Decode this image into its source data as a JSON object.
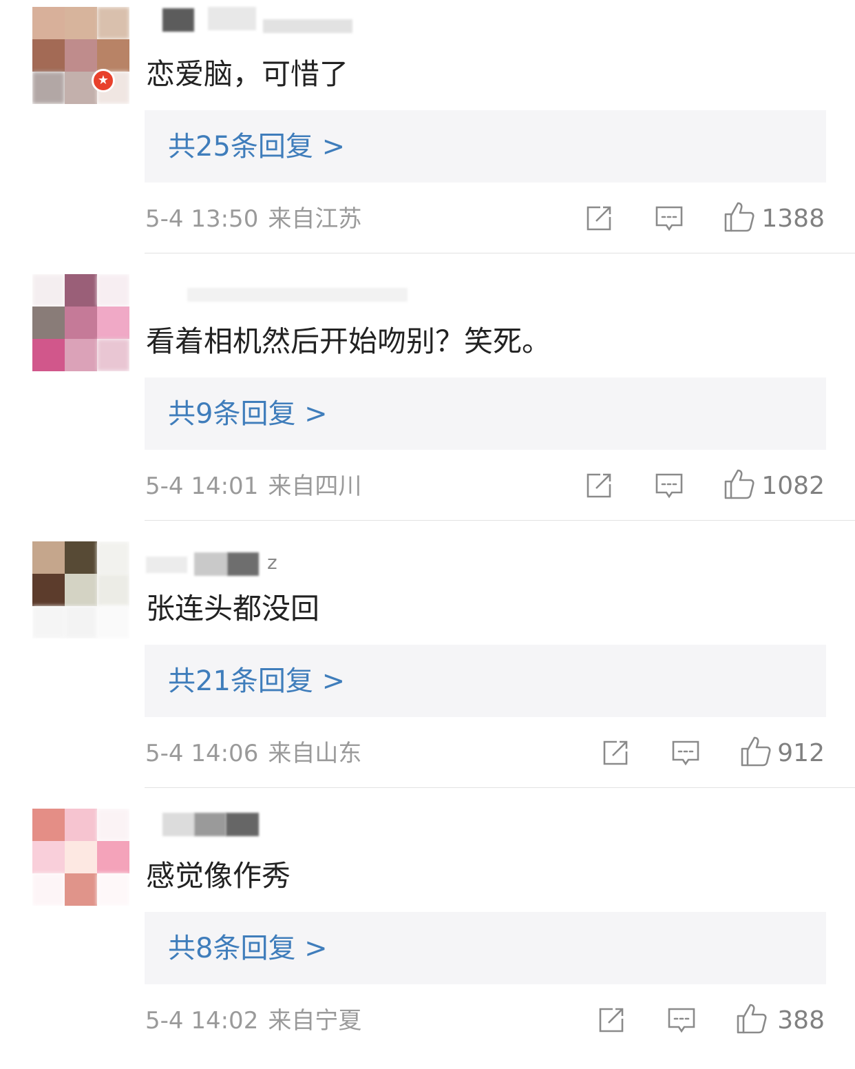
{
  "comments": [
    {
      "username_tail": "",
      "text": "恋爱脑，可惜了",
      "replies_label": "共25条回复 >",
      "time": "5-4 13:50",
      "location": "来自江苏",
      "likes": "1388",
      "verified": true
    },
    {
      "username_tail": "",
      "text": "看着相机然后开始吻别？笑死。",
      "replies_label": "共9条回复 >",
      "time": "5-4 14:01",
      "location": "来自四川",
      "likes": "1082",
      "verified": false
    },
    {
      "username_tail": "z",
      "text": "张连头都没回",
      "replies_label": "共21条回复 >",
      "time": "5-4 14:06",
      "location": "来自山东",
      "likes": "912",
      "verified": false
    },
    {
      "username_tail": "",
      "text": "感觉像作秀",
      "replies_label": "共8条回复 >",
      "time": "5-4 14:02",
      "location": "来自宁夏",
      "likes": "388",
      "verified": false
    }
  ],
  "icons": {
    "repost": "repost-icon",
    "comment": "comment-icon",
    "like": "thumbs-up-icon"
  },
  "colors": {
    "link": "#3f7dbb",
    "reply_bg": "#f5f5f7",
    "meta": "#9a9a9a",
    "badge": "#e8412c"
  }
}
